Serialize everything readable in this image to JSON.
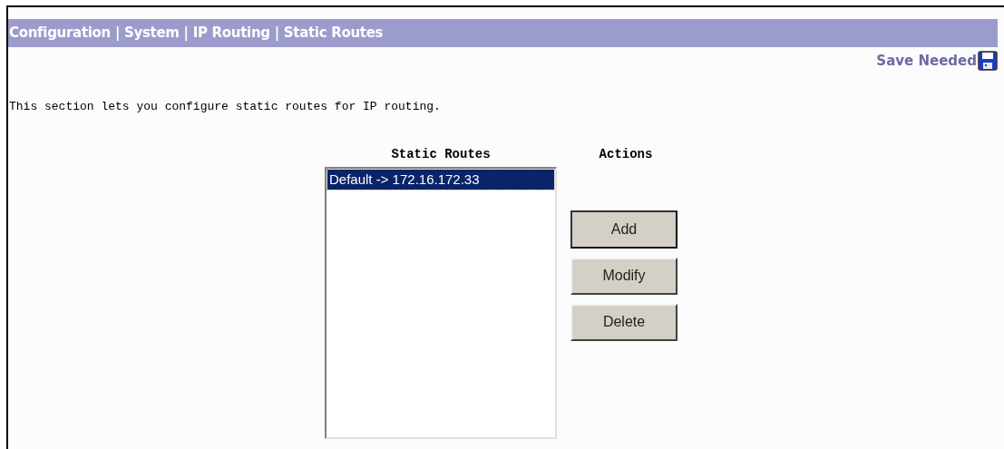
{
  "breadcrumb": "Configuration | System | IP Routing | Static Routes",
  "save_status": "Save Needed",
  "description": "This section lets you configure static routes for IP routing.",
  "routes_heading": "Static Routes",
  "actions_heading": "Actions",
  "routes": [
    {
      "label": "Default -> 172.16.172.33",
      "selected": true
    }
  ],
  "buttons": [
    {
      "label": "Add",
      "default": true
    },
    {
      "label": "Modify",
      "default": false
    },
    {
      "label": "Delete",
      "default": false
    }
  ]
}
